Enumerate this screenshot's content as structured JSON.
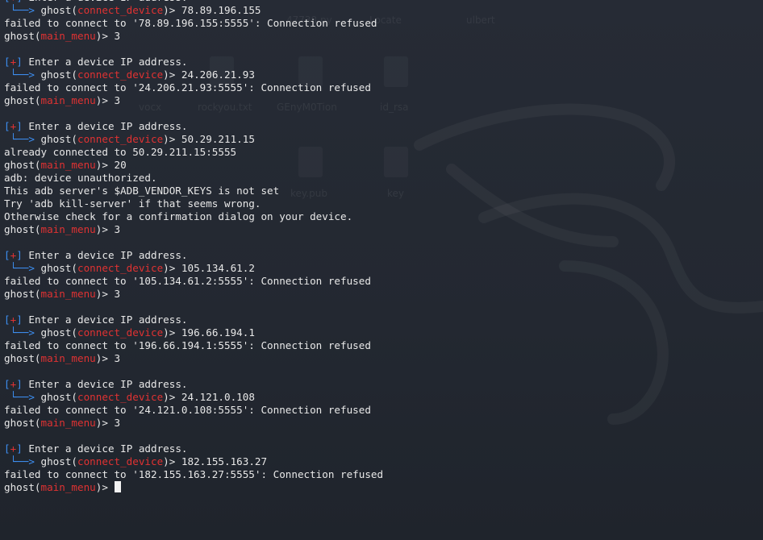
{
  "desktop": {
    "labels": [
      "47738.py",
      "Locate",
      "ulbert",
      "vocx",
      "rockyou.txt",
      "GEnyM0Tion",
      "id_rsa",
      "key.pub",
      "key"
    ]
  },
  "terminal": {
    "prompt_user": "ghost",
    "cursor_icon": "block-cursor-icon",
    "blocks": [
      {
        "enter_label": "Enter a device IP address.",
        "context": "connect_device",
        "ip": "78.89.196.155",
        "output": [
          "failed to connect to '78.89.196.155:5555': Connection refused"
        ],
        "menu_context": "main_menu",
        "menu_choice": "3"
      },
      {
        "enter_label": "Enter a device IP address.",
        "context": "connect_device",
        "ip": "24.206.21.93",
        "output": [
          "failed to connect to '24.206.21.93:5555': Connection refused"
        ],
        "menu_context": "main_menu",
        "menu_choice": "3"
      },
      {
        "enter_label": "Enter a device IP address.",
        "context": "connect_device",
        "ip": "50.29.211.15",
        "output": [
          "already connected to 50.29.211.15:5555"
        ],
        "menu_context": "main_menu",
        "menu_choice": "20",
        "extra_output": [
          "adb: device unauthorized.",
          "This adb server's $ADB_VENDOR_KEYS is not set",
          "Try 'adb kill-server' if that seems wrong.",
          "Otherwise check for a confirmation dialog on your device."
        ],
        "menu_context_2": "main_menu",
        "menu_choice_2": "3"
      },
      {
        "enter_label": "Enter a device IP address.",
        "context": "connect_device",
        "ip": "105.134.61.2",
        "output": [
          "failed to connect to '105.134.61.2:5555': Connection refused"
        ],
        "menu_context": "main_menu",
        "menu_choice": "3"
      },
      {
        "enter_label": "Enter a device IP address.",
        "context": "connect_device",
        "ip": "196.66.194.1",
        "output": [
          "failed to connect to '196.66.194.1:5555': Connection refused"
        ],
        "menu_context": "main_menu",
        "menu_choice": "3"
      },
      {
        "enter_label": "Enter a device IP address.",
        "context": "connect_device",
        "ip": "24.121.0.108",
        "output": [
          "failed to connect to '24.121.0.108:5555': Connection refused"
        ],
        "menu_context": "main_menu",
        "menu_choice": "3"
      },
      {
        "enter_label": "Enter a device IP address.",
        "context": "connect_device",
        "ip": "182.155.163.27",
        "output": [
          "failed to connect to '182.155.163.27:5555': Connection refused"
        ],
        "menu_context": "main_menu",
        "menu_choice": ""
      }
    ]
  }
}
